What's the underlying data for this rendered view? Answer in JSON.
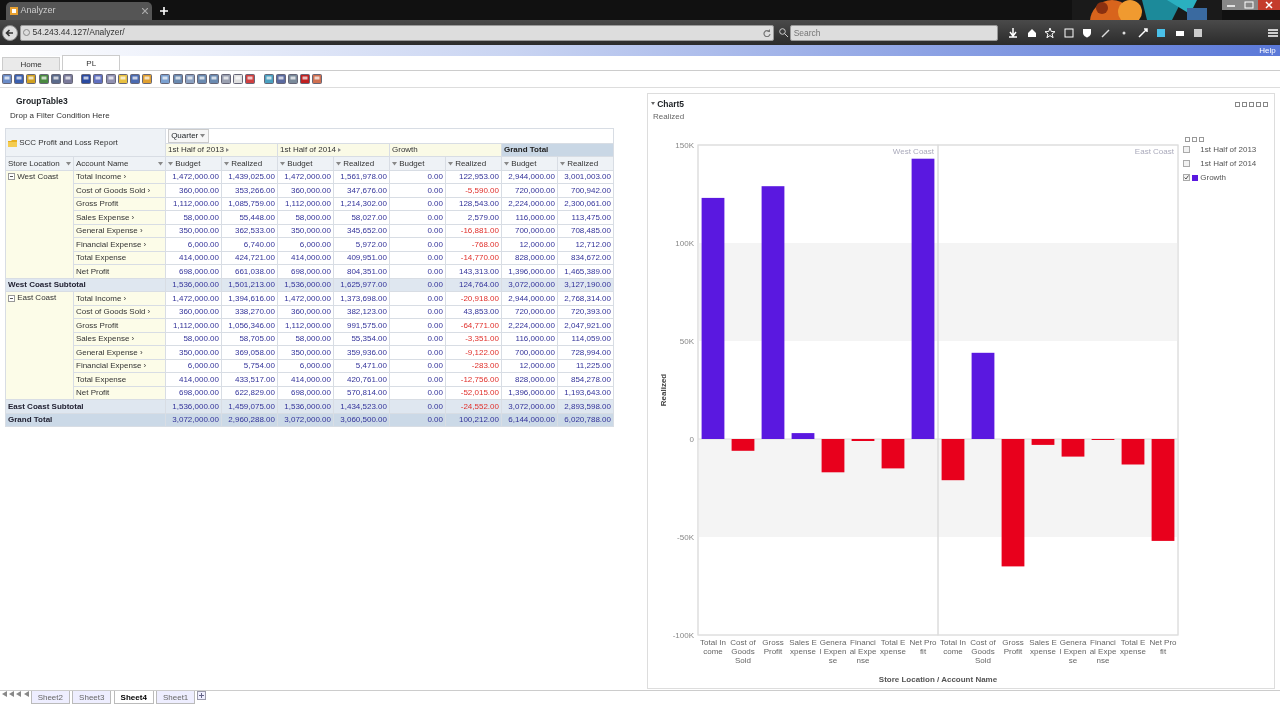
{
  "browser": {
    "tab_title": "Analyzer",
    "url": "54.243.44.127/Analyzer/",
    "search": {
      "placeholder": "Search"
    },
    "header_link": "Help"
  },
  "app_tabs": [
    {
      "label": "Home",
      "selected": false
    },
    {
      "label": "PL",
      "selected": true
    }
  ],
  "group_table": {
    "title": "GroupTable3",
    "filter_hint": "Drop a Filter Condition Here",
    "report_title": "SCC Profit and Loss Report",
    "column_field": "Quarter",
    "column_groups": [
      {
        "label": "1st Half of 2013",
        "kind": "period",
        "measures": [
          "Budget",
          "Realized"
        ]
      },
      {
        "label": "1st Half of 2014",
        "kind": "period",
        "measures": [
          "Budget",
          "Realized"
        ]
      },
      {
        "label": "Growth",
        "kind": "growth",
        "measures": [
          "Budget",
          "Realized"
        ]
      },
      {
        "label": "Grand Total",
        "kind": "total",
        "measures": [
          "Budget",
          "Realized"
        ]
      }
    ],
    "row_fields": [
      "Store Location",
      "Account Name"
    ],
    "groups": [
      {
        "name": "West Coast",
        "expanded": true,
        "rows": [
          {
            "account": "Total Income ›",
            "values": [
              "1,472,000.00",
              "1,439,025.00",
              "1,472,000.00",
              "1,561,978.00",
              "0.00",
              "122,953.00",
              "2,944,000.00",
              "3,001,003.00"
            ]
          },
          {
            "account": "Cost of Goods Sold ›",
            "values": [
              "360,000.00",
              "353,266.00",
              "360,000.00",
              "347,676.00",
              "0.00",
              "-5,590.00",
              "720,000.00",
              "700,942.00"
            ]
          },
          {
            "account": "Gross Profit",
            "values": [
              "1,112,000.00",
              "1,085,759.00",
              "1,112,000.00",
              "1,214,302.00",
              "0.00",
              "128,543.00",
              "2,224,000.00",
              "2,300,061.00"
            ]
          },
          {
            "account": "Sales Expense ›",
            "values": [
              "58,000.00",
              "55,448.00",
              "58,000.00",
              "58,027.00",
              "0.00",
              "2,579.00",
              "116,000.00",
              "113,475.00"
            ]
          },
          {
            "account": "General Expense ›",
            "values": [
              "350,000.00",
              "362,533.00",
              "350,000.00",
              "345,652.00",
              "0.00",
              "-16,881.00",
              "700,000.00",
              "708,485.00"
            ]
          },
          {
            "account": "Financial Expense ›",
            "values": [
              "6,000.00",
              "6,740.00",
              "6,000.00",
              "5,972.00",
              "0.00",
              "-768.00",
              "12,000.00",
              "12,712.00"
            ]
          },
          {
            "account": "Total Expense",
            "values": [
              "414,000.00",
              "424,721.00",
              "414,000.00",
              "409,951.00",
              "0.00",
              "-14,770.00",
              "828,000.00",
              "834,672.00"
            ]
          },
          {
            "account": "Net Profit",
            "values": [
              "698,000.00",
              "661,038.00",
              "698,000.00",
              "804,351.00",
              "0.00",
              "143,313.00",
              "1,396,000.00",
              "1,465,389.00"
            ]
          }
        ],
        "subtotal": {
          "label": "West Coast Subtotal",
          "values": [
            "1,536,000.00",
            "1,501,213.00",
            "1,536,000.00",
            "1,625,977.00",
            "0.00",
            "124,764.00",
            "3,072,000.00",
            "3,127,190.00"
          ]
        }
      },
      {
        "name": "East Coast",
        "expanded": true,
        "rows": [
          {
            "account": "Total Income ›",
            "values": [
              "1,472,000.00",
              "1,394,616.00",
              "1,472,000.00",
              "1,373,698.00",
              "0.00",
              "-20,918.00",
              "2,944,000.00",
              "2,768,314.00"
            ]
          },
          {
            "account": "Cost of Goods Sold ›",
            "values": [
              "360,000.00",
              "338,270.00",
              "360,000.00",
              "382,123.00",
              "0.00",
              "43,853.00",
              "720,000.00",
              "720,393.00"
            ]
          },
          {
            "account": "Gross Profit",
            "values": [
              "1,112,000.00",
              "1,056,346.00",
              "1,112,000.00",
              "991,575.00",
              "0.00",
              "-64,771.00",
              "2,224,000.00",
              "2,047,921.00"
            ]
          },
          {
            "account": "Sales Expense ›",
            "values": [
              "58,000.00",
              "58,705.00",
              "58,000.00",
              "55,354.00",
              "0.00",
              "-3,351.00",
              "116,000.00",
              "114,059.00"
            ]
          },
          {
            "account": "General Expense ›",
            "values": [
              "350,000.00",
              "369,058.00",
              "350,000.00",
              "359,936.00",
              "0.00",
              "-9,122.00",
              "700,000.00",
              "728,994.00"
            ]
          },
          {
            "account": "Financial Expense ›",
            "values": [
              "6,000.00",
              "5,754.00",
              "6,000.00",
              "5,471.00",
              "0.00",
              "-283.00",
              "12,000.00",
              "11,225.00"
            ]
          },
          {
            "account": "Total Expense",
            "values": [
              "414,000.00",
              "433,517.00",
              "414,000.00",
              "420,761.00",
              "0.00",
              "-12,756.00",
              "828,000.00",
              "854,278.00"
            ]
          },
          {
            "account": "Net Profit",
            "values": [
              "698,000.00",
              "622,829.00",
              "698,000.00",
              "570,814.00",
              "0.00",
              "-52,015.00",
              "1,396,000.00",
              "1,193,643.00"
            ]
          }
        ],
        "subtotal": {
          "label": "East Coast Subtotal",
          "values": [
            "1,536,000.00",
            "1,459,075.00",
            "1,536,000.00",
            "1,434,523.00",
            "0.00",
            "-24,552.00",
            "3,072,000.00",
            "2,893,598.00"
          ]
        }
      }
    ],
    "grand_total": {
      "label": "Grand Total",
      "values": [
        "3,072,000.00",
        "2,960,288.00",
        "3,072,000.00",
        "3,060,500.00",
        "0.00",
        "100,212.00",
        "6,144,000.00",
        "6,020,788.00"
      ]
    }
  },
  "chart": {
    "subtitle": "Realized",
    "groups": [
      {
        "label": "West Coast"
      },
      {
        "label": "East Coast"
      }
    ],
    "legend": [
      {
        "label": "1st Half of 2013",
        "checked": false
      },
      {
        "label": "1st Half of 2014",
        "checked": false
      },
      {
        "kind": "series",
        "checked": true
      }
    ],
    "chart_data": {
      "type": "bar",
      "title": "Chart5",
      "xlabel": "Store Location / Account Name",
      "ylabel": "Realized",
      "categories": [
        "Total Income",
        "Cost of Goods Sold",
        "Gross Profit",
        "Sales Expense",
        "General Expense",
        "Financial Expense",
        "Total Expense",
        "Net Profit",
        "Total Income",
        "Cost of Goods Sold",
        "Gross Profit",
        "Sales Expense",
        "General Expense",
        "Financial Expense",
        "Total Expense",
        "Net Profit"
      ],
      "series": [
        {
          "name": "Growth",
          "color": "#5a18e0",
          "values": [
            123000,
            null,
            129000,
            3000,
            null,
            null,
            null,
            143000,
            null,
            44000,
            null,
            null,
            null,
            null,
            null,
            null
          ]
        },
        {
          "color": "#e8001c",
          "values": [
            null,
            -6000,
            null,
            null,
            -17000,
            -1000,
            -15000,
            null,
            -21000,
            null,
            -65000,
            -3000,
            -9000,
            0,
            -13000,
            -52000
          ]
        }
      ],
      "ylim": [
        -100000,
        150000
      ],
      "yticks": [
        {
          "value": 150000,
          "label": "150K"
        },
        {
          "value": 100000,
          "label": "100K"
        },
        {
          "value": 50000,
          "label": "50K"
        },
        {
          "value": 0,
          "label": "0"
        },
        {
          "value": -50000,
          "label": "-50K"
        },
        {
          "value": -100000,
          "label": "-100K"
        }
      ]
    }
  },
  "sheet_tabs": [
    {
      "label": "Sheet2",
      "selected": false
    },
    {
      "label": "Sheet3",
      "selected": false
    },
    {
      "label": "Sheet4",
      "selected": true
    },
    {
      "label": "Sheet1",
      "selected": false
    }
  ]
}
